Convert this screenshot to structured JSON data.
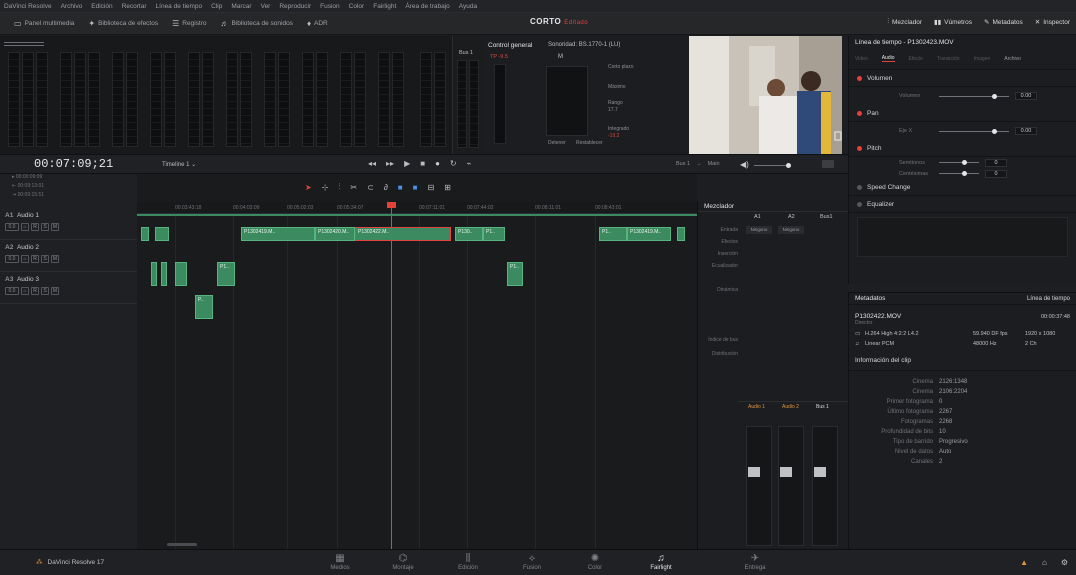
{
  "menu": [
    "DaVinci Resolve",
    "Archivo",
    "Edición",
    "Recortar",
    "Línea de tiempo",
    "Clip",
    "Marcar",
    "Ver",
    "Reproducir",
    "Fusion",
    "Color",
    "Fairlight",
    "Área de trabajo",
    "Ayuda"
  ],
  "toolbar": {
    "media_pool": "Panel multimedia",
    "effects": "Biblioteca de efectos",
    "index": "Registro",
    "sound_library": "Biblioteca de sonidos",
    "adr": "ADR",
    "project_title": "CORTO",
    "project_status": "Editado",
    "right_tabs": [
      "Mezclador",
      "Vúmetros",
      "Metadatos",
      "Inspector"
    ]
  },
  "control": {
    "title": "Control general",
    "loudness": "Sonoridad: BS.1770-1 (LU)",
    "bus": "Bus 1",
    "tp": "TP -9.5",
    "m": "M",
    "short": "Corto plazo",
    "max": "Máximo",
    "range": "Rango",
    "range_val": "17.7",
    "integrated": "Integrado",
    "integrated_val": "-19.2",
    "pause": "Detener",
    "restart": "Restablecer"
  },
  "timeline": {
    "timecode": "00:07:09;21",
    "name": "Timeline 1",
    "tc_rows": [
      "00:00:09:09",
      "00:09:13:01",
      "00:09:15:51"
    ],
    "ruler": [
      "00:03:43:18",
      "00:04:03:09",
      "00:05:02:03",
      "00:05:34:07",
      "00:06:34:02",
      "00:07:11:01",
      "00:07:44:02",
      "00:08:11:01",
      "00:08:43:01",
      "00:09:"
    ],
    "view_label": "Bus 1",
    "main_label": "Main"
  },
  "tracks": [
    {
      "id": "A1",
      "name": "Audio 1",
      "vol": "0.0"
    },
    {
      "id": "A2",
      "name": "Audio 2",
      "vol": "0.0"
    },
    {
      "id": "A3",
      "name": "Audio 3",
      "vol": "0.0"
    }
  ],
  "clips_a1": [
    "P1302419.M..",
    "P1302419.M..",
    "P1302420.M..",
    "P1302422.M..",
    "P130..",
    "P1..",
    "P1..",
    "P1..",
    "P1302419.M.."
  ],
  "clips_a2": [
    "P1..",
    "P1..",
    "P1..",
    "P1..",
    "P1.."
  ],
  "clips_a3": [
    "P..",
    "P.."
  ],
  "mixer": {
    "title": "Mezclador",
    "cols": [
      "A1",
      "A2",
      "Bus1"
    ],
    "rows": [
      "Entrada",
      "Efectos",
      "Inserción",
      "Ecualizador",
      "Dinámica",
      "Índice de bus",
      "Distribución"
    ],
    "input": [
      "Ninguno",
      "Ninguno"
    ],
    "channels": [
      "Audio 1",
      "Audio 2",
      "Bus 1"
    ],
    "faders": [
      "0.0",
      "0.0",
      "0.0"
    ]
  },
  "inspector": {
    "title": "Línea de tiempo - P1302423.MOV",
    "tabs": [
      "Video",
      "Audio",
      "Efecto",
      "Transición",
      "Imagen",
      "Archivo"
    ],
    "volume": "Volumen",
    "volume_label": "Volumen",
    "volume_val": "0.00",
    "pan": "Pan",
    "pan_label": "Eje X",
    "pan_val": "0.00",
    "pitch": "Pitch",
    "semitones": "Semitonos",
    "semitones_val": "0",
    "cents": "Centésimas",
    "cents_val": "0",
    "speed": "Speed Change",
    "eq": "Equalizer"
  },
  "metadata": {
    "title": "Metadatos",
    "tab": "Línea de tiempo",
    "clip": "P1302422.MOV",
    "clip_sub": "Director",
    "duration": "00:00:37:48",
    "codec": "H.264 High 4:2:2 L4.2",
    "fps": "59.940 DF fps",
    "res": "1920 x 1080",
    "audio": "Linear PCM",
    "hz": "48000 Hz",
    "ch": "2 Ch",
    "info": "Información del clip",
    "fields": [
      {
        "k": "Cinema",
        "v": "2126:1348"
      },
      {
        "k": "Cinema",
        "v": "2106:2204"
      },
      {
        "k": "Primer fotograma",
        "v": "0"
      },
      {
        "k": "Último fotograma",
        "v": "2267"
      },
      {
        "k": "Fotogramas",
        "v": "2268"
      },
      {
        "k": "Profundidad de bits",
        "v": "10"
      },
      {
        "k": "Tipo de barrido",
        "v": "Progresivo"
      },
      {
        "k": "Nivel de datos",
        "v": "Auto"
      },
      {
        "k": "Canales",
        "v": "2"
      }
    ]
  },
  "bottom": {
    "app": "DaVinci Resolve 17",
    "tabs": [
      "Medios",
      "Montaje",
      "Edición",
      "Fusion",
      "Color",
      "Fairlight",
      "Entrega"
    ],
    "active": "Fairlight"
  }
}
